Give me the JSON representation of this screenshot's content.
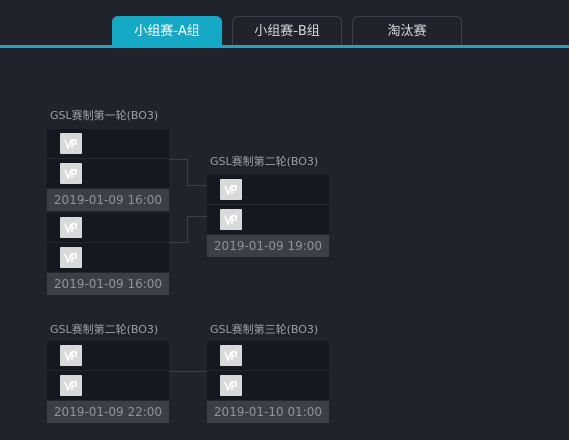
{
  "tabs": [
    {
      "label": "小组赛-A组",
      "active": true
    },
    {
      "label": "小组赛-B组",
      "active": false
    },
    {
      "label": "淘汰赛",
      "active": false
    }
  ],
  "rounds": {
    "r1_title": "GSL赛制第一轮(BO3)",
    "r2_title": "GSL赛制第二轮(BO3)",
    "r2b_title": "GSL赛制第二轮(BO3)",
    "r3_title": "GSL赛制第三轮(BO3)"
  },
  "matches": [
    {
      "time": "2019-01-09 16:00",
      "teams": [
        "VP logo",
        "VP logo"
      ]
    },
    {
      "time": "2019-01-09 16:00",
      "teams": [
        "VP logo",
        "VP logo"
      ]
    },
    {
      "time": "2019-01-09 19:00",
      "teams": [
        "VP logo",
        "VP logo"
      ]
    },
    {
      "time": "2019-01-09 22:00",
      "teams": [
        "VP logo",
        "VP logo"
      ]
    },
    {
      "time": "2019-01-10 01:00",
      "teams": [
        "VP logo",
        "VP logo"
      ]
    }
  ],
  "icons": {
    "team_logo": "vp-team-logo-icon"
  },
  "colors": {
    "accent": "#16a9c6",
    "background": "#20232b",
    "slot": "#15181e",
    "time_bar": "#3b3f46"
  }
}
